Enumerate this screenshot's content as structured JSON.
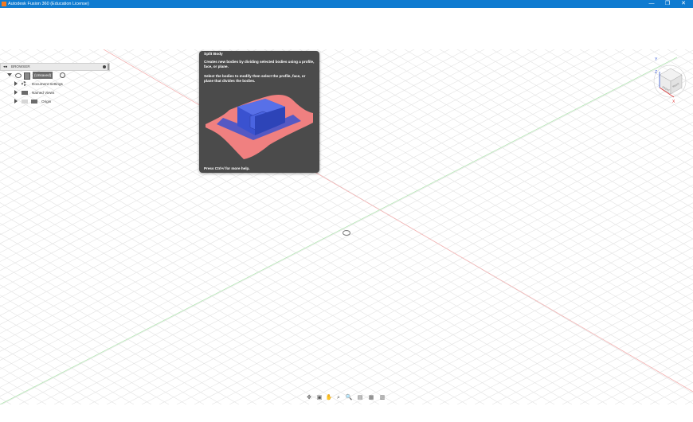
{
  "window": {
    "title": "Autodesk Fusion 360 (Education License)",
    "controls": {
      "minimize": "—",
      "maximize": "❐",
      "close": "✕"
    }
  },
  "browser": {
    "header_label": "BROWSER",
    "collapse_glyph": "◂◂",
    "root_label": "(Unsaved)",
    "items": [
      {
        "label": "Document Settings"
      },
      {
        "label": "Named Views"
      },
      {
        "label": "Origin"
      }
    ]
  },
  "tooltip": {
    "title": "Split Body",
    "description": "Creates new bodies by dividing selected bodies using a profile, face, or plane.",
    "instructions": "Select the bodies to modify then select the profile, face, or plane that divides the bodies.",
    "footer": "Press Ctrl+/ for more help."
  },
  "viewcube": {
    "axis_z": "Z",
    "axis_x": "X",
    "axis_y": "Y",
    "face_front": "FRONT",
    "face_right": "RIGHT"
  },
  "colors": {
    "titlebar": "#0f7bd0",
    "grid_line": "#e3e3e3",
    "axis_red": "#f0a0a0",
    "axis_green": "#a0e0a0",
    "tooltip_bg": "#4b4b4b",
    "body_blue": "#3a52d0",
    "plane_red": "#f08080"
  },
  "nav_bar": {
    "icons": [
      "orbit-icon",
      "look-at-icon",
      "pan-icon",
      "zoom-window-icon",
      "zoom-icon",
      "display-settings-icon",
      "grid-settings-icon",
      "viewports-icon"
    ]
  }
}
